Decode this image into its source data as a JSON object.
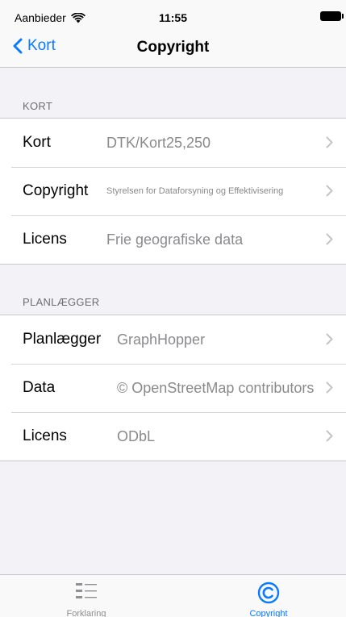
{
  "status_bar": {
    "carrier": "Aanbieder",
    "time": "11:55"
  },
  "nav": {
    "back_label": "Kort",
    "title": "Copyright"
  },
  "sections": [
    {
      "header": "KORT",
      "rows": [
        {
          "label": "Kort",
          "value": "DTK/Kort25,250"
        },
        {
          "label": "Copyright",
          "value": "Styrelsen for Dataforsyning og Effektivisering"
        },
        {
          "label": "Licens",
          "value": "Frie geografiske data"
        }
      ]
    },
    {
      "header": "PLANLÆGGER",
      "rows": [
        {
          "label": "Planlægger",
          "value": "GraphHopper"
        },
        {
          "label": "Data",
          "value": "© OpenStreetMap contributors"
        },
        {
          "label": "Licens",
          "value": "ODbL"
        }
      ]
    }
  ],
  "tabs": [
    {
      "label": "Forklaring",
      "icon": "list-icon",
      "selected": false
    },
    {
      "label": "Copyright",
      "icon": "copyright-icon",
      "selected": true
    }
  ],
  "colors": {
    "accent": "#0a7aff",
    "inactive": "#8e8e93",
    "secondary_text": "#8a8a8e"
  }
}
